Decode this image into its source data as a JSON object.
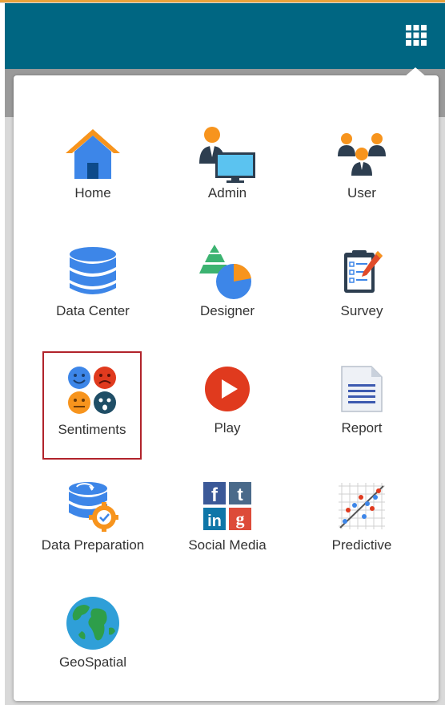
{
  "header": {
    "menu_icon": "grid-icon",
    "brand_color": "#006682"
  },
  "apps": [
    {
      "label": "Home",
      "icon": "home-icon"
    },
    {
      "label": "Admin",
      "icon": "admin-icon"
    },
    {
      "label": "User",
      "icon": "users-icon"
    },
    {
      "label": "Data Center",
      "icon": "database-icon"
    },
    {
      "label": "Designer",
      "icon": "designer-icon"
    },
    {
      "label": "Survey",
      "icon": "survey-icon"
    },
    {
      "label": "Sentiments",
      "icon": "sentiments-icon",
      "selected": true
    },
    {
      "label": "Play",
      "icon": "play-icon"
    },
    {
      "label": "Report",
      "icon": "report-icon"
    },
    {
      "label": "Data Preparation",
      "icon": "data-preparation-icon"
    },
    {
      "label": "Social Media",
      "icon": "social-media-icon"
    },
    {
      "label": "Predictive",
      "icon": "predictive-icon"
    },
    {
      "label": "GeoSpatial",
      "icon": "globe-icon"
    }
  ],
  "colors": {
    "selection_border": "#b1232b",
    "icon_blue": "#3d86e8",
    "icon_orange": "#f7941d"
  }
}
